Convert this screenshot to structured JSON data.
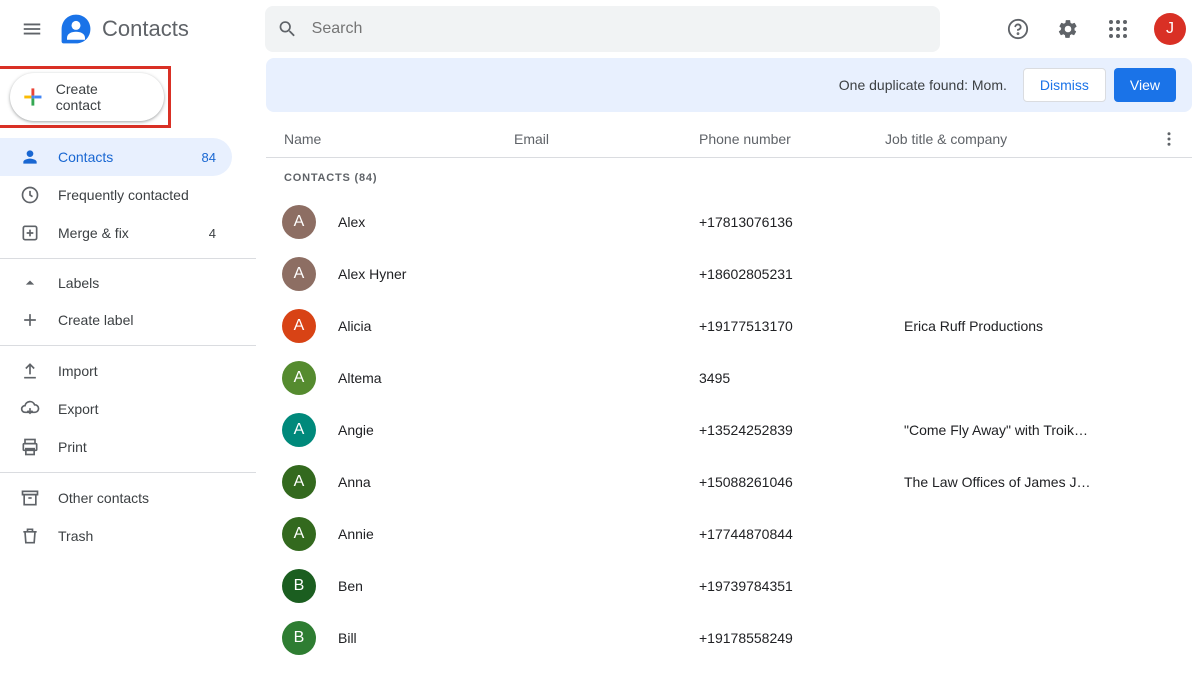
{
  "header": {
    "app_name": "Contacts",
    "search_placeholder": "Search",
    "avatar_letter": "J"
  },
  "create_button": {
    "label": "Create contact"
  },
  "sidebar": {
    "contacts": {
      "label": "Contacts",
      "count": "84"
    },
    "frequently": {
      "label": "Frequently contacted"
    },
    "merge": {
      "label": "Merge & fix",
      "count": "4"
    },
    "labels_header": "Labels",
    "create_label": "Create label",
    "import": "Import",
    "export": "Export",
    "print": "Print",
    "other": "Other contacts",
    "trash": "Trash"
  },
  "banner": {
    "message": "One duplicate found: Mom.",
    "dismiss": "Dismiss",
    "view": "View"
  },
  "columns": {
    "name": "Name",
    "email": "Email",
    "phone": "Phone number",
    "job": "Job title & company"
  },
  "section_label": "CONTACTS (84)",
  "contacts": [
    {
      "letter": "A",
      "color": "#8d6e63",
      "name": "Alex",
      "phone": "+17813076136",
      "job": ""
    },
    {
      "letter": "A",
      "color": "#8d6e63",
      "name": "Alex Hyner",
      "phone": "+18602805231",
      "job": ""
    },
    {
      "letter": "A",
      "color": "#d84315",
      "name": "Alicia",
      "phone": "+19177513170",
      "job": "Erica Ruff Productions"
    },
    {
      "letter": "A",
      "color": "#558b2f",
      "name": "Altema",
      "phone": "3495",
      "job": ""
    },
    {
      "letter": "A",
      "color": "#00897b",
      "name": "Angie",
      "phone": "+13524252839",
      "job": "\"Come Fly Away\" with Troik…"
    },
    {
      "letter": "A",
      "color": "#33691e",
      "name": "Anna",
      "phone": "+15088261046",
      "job": "The Law Offices of James J…"
    },
    {
      "letter": "A",
      "color": "#33691e",
      "name": "Annie",
      "phone": "+17744870844",
      "job": ""
    },
    {
      "letter": "B",
      "color": "#1b5e20",
      "name": "Ben",
      "phone": "+19739784351",
      "job": ""
    },
    {
      "letter": "B",
      "color": "#2e7d32",
      "name": "Bill",
      "phone": "+19178558249",
      "job": ""
    }
  ]
}
